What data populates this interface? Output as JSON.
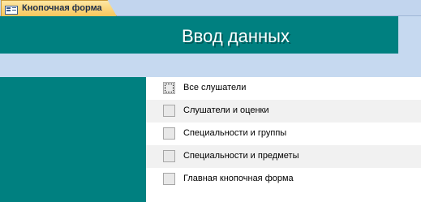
{
  "tab": {
    "icon": "form-icon",
    "label": "Кнопочная форма"
  },
  "header": {
    "title": "Ввод данных"
  },
  "colors": {
    "accent": "#008080",
    "background": "#c6d9f0",
    "tab_fill": "#f7c65c",
    "row_alt": "#f1f1f1"
  },
  "items": [
    {
      "label": "Все слушатели",
      "focused": true
    },
    {
      "label": "Слушатели и оценки",
      "focused": false
    },
    {
      "label": "Специальности и группы",
      "focused": false
    },
    {
      "label": "Специальности и предметы",
      "focused": false
    },
    {
      "label": "Главная кнопочная форма",
      "focused": false
    }
  ]
}
